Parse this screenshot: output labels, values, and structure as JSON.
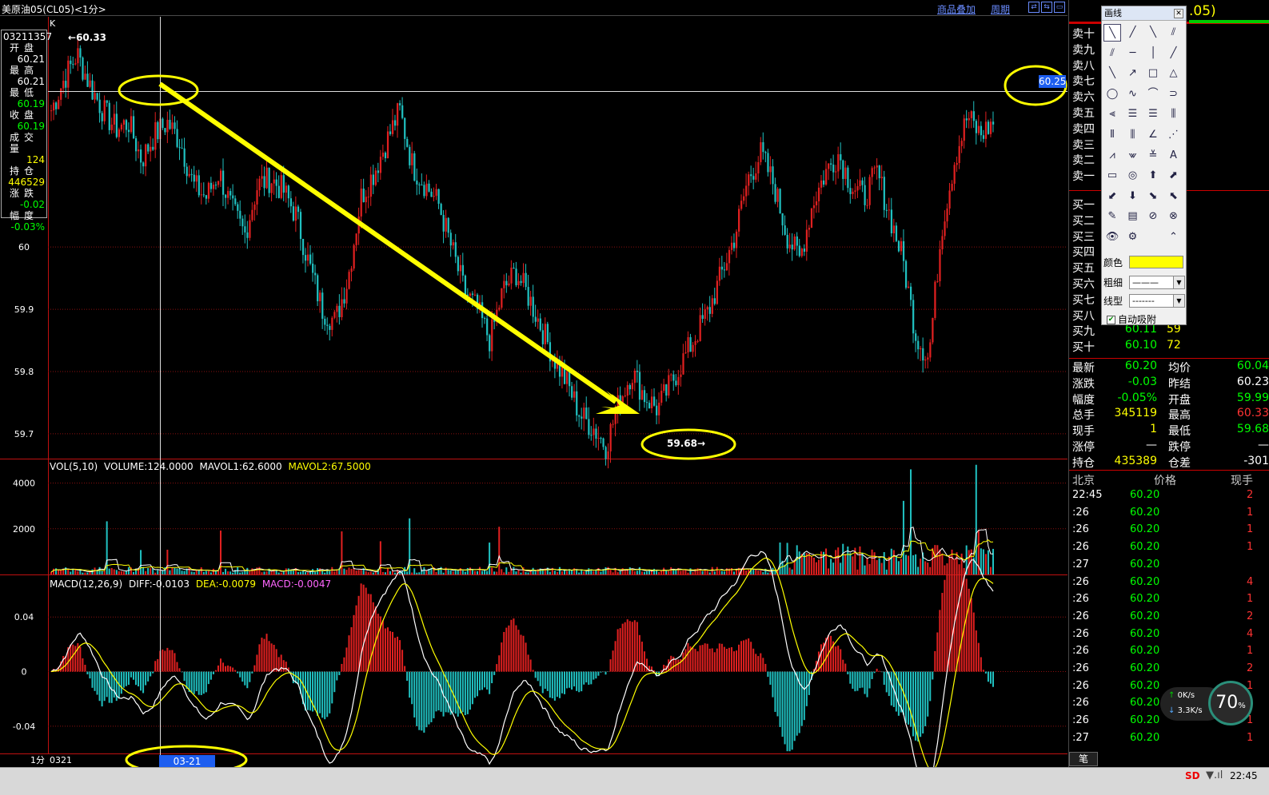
{
  "topbar": {
    "title": "美原油05(CL05)<1分>",
    "overlay_link": "商品叠加",
    "period_link": "周期",
    "nav_buttons": [
      "⇄",
      "⇆",
      "▭"
    ]
  },
  "chart_data": [
    {
      "type": "candlestick",
      "name": "",
      "indicator_label": "K",
      "ylim": [
        59.66,
        60.37
      ],
      "y_ticks": [
        60.0,
        59.9,
        59.8,
        59.7
      ],
      "high_marker": "60.33",
      "low_marker": "59.68",
      "crosshair_price": "60.25",
      "crosshair_date": "03-21 13:57",
      "price_path": [
        60.22,
        60.27,
        60.31,
        60.26,
        60.22,
        60.19,
        60.2,
        60.14,
        60.18,
        60.2,
        60.17,
        60.1,
        60.08,
        60.12,
        60.06,
        60.02,
        60.1,
        60.11,
        60.09,
        60.05,
        59.97,
        59.9,
        59.88,
        59.95,
        60.08,
        60.12,
        60.17,
        60.22,
        60.13,
        60.1,
        60.07,
        60.0,
        59.93,
        59.9,
        59.85,
        59.93,
        59.96,
        59.92,
        59.87,
        59.82,
        59.78,
        59.73,
        59.71,
        59.68,
        59.75,
        59.8,
        59.76,
        59.74,
        59.78,
        59.82,
        59.86,
        59.9,
        59.96,
        60.02,
        60.11,
        60.15,
        60.1,
        60.02,
        59.98,
        60.07,
        60.12,
        60.15,
        60.1,
        60.08,
        60.12,
        60.05,
        59.98,
        59.86,
        59.82,
        60.03,
        60.14,
        60.21,
        60.18,
        60.2
      ]
    },
    {
      "type": "bar",
      "name": "",
      "indicator_label": "VOL(5,10)",
      "volume_label": "VOLUME:124.0000",
      "mavol1_label": "MAVOL1:62.6000",
      "mavol2_label": "MAVOL2:67.5000",
      "ylim": [
        0,
        5000
      ],
      "y_ticks": [
        4000,
        2000
      ]
    },
    {
      "type": "bar",
      "name": "",
      "indicator_label": "MACD(12,26,9)",
      "diff_label": "DIFF:-0.0103",
      "dea_label": "DEA:-0.0079",
      "macd_label": "MACD:-0.0047",
      "ylim": [
        -0.06,
        0.07
      ],
      "y_ticks": [
        0.04,
        0,
        -0.04
      ],
      "y_tick_labels": [
        "0.04",
        "0",
        "-0.04"
      ]
    }
  ],
  "bottom": {
    "period": "1分",
    "date": "0321"
  },
  "info_box": {
    "code": "03211357",
    "rows": [
      {
        "label": "开盘",
        "value": "60.21",
        "color": "#ffffff"
      },
      {
        "label": "最高",
        "value": "60.21",
        "color": "#ffffff"
      },
      {
        "label": "最低",
        "value": "60.19",
        "color": "#00ff00"
      },
      {
        "label": "收盘",
        "value": "60.19",
        "color": "#00ff00"
      },
      {
        "label": "成交量",
        "value": "124",
        "color": "#ffff00"
      },
      {
        "label": "持仓",
        "value": "446529",
        "color": "#ffff00"
      },
      {
        "label": "涨跌",
        "value": "-0.02",
        "color": "#00ff00"
      },
      {
        "label": "幅度",
        "value": "-0.03%",
        "color": "#00ff00"
      }
    ]
  },
  "right_panel": {
    "header_code": ".05)",
    "sell_labels": [
      "卖十",
      "卖九",
      "卖八",
      "卖七",
      "卖六",
      "卖五",
      "卖四",
      "卖三",
      "卖二",
      "卖一"
    ],
    "buy_labels": [
      "买一",
      "买二",
      "买三",
      "买四",
      "买五",
      "买六",
      "买七",
      "买八"
    ],
    "buy_with_values": [
      {
        "label": "买九",
        "price": "60.11",
        "vol": "59"
      },
      {
        "label": "买十",
        "price": "60.10",
        "vol": "72"
      }
    ],
    "quote": [
      {
        "l1": "最新",
        "v1": "60.20",
        "c1": "#00ff00",
        "l2": "均价",
        "v2": "60.04",
        "c2": "#00ff00"
      },
      {
        "l1": "涨跌",
        "v1": "-0.03",
        "c1": "#00ff00",
        "l2": "昨结",
        "v2": "60.23",
        "c2": "#ffffff"
      },
      {
        "l1": "幅度",
        "v1": "-0.05%",
        "c1": "#00ff00",
        "l2": "开盘",
        "v2": "59.99",
        "c2": "#00ff00"
      },
      {
        "l1": "总手",
        "v1": "345119",
        "c1": "#ffff00",
        "l2": "最高",
        "v2": "60.33",
        "c2": "#ff3333"
      },
      {
        "l1": "现手",
        "v1": "1",
        "c1": "#ffff00",
        "l2": "最低",
        "v2": "59.68",
        "c2": "#00ff00"
      },
      {
        "l1": "涨停",
        "v1": "—",
        "c1": "#ffffff",
        "l2": "跌停",
        "v2": "—",
        "c2": "#ffffff"
      },
      {
        "l1": "持仓",
        "v1": "435389",
        "c1": "#ffff00",
        "l2": "仓差",
        "v2": "-301",
        "c2": "#ffffff"
      }
    ],
    "ticks_header": {
      "time": "北京",
      "price": "价格",
      "vol": "现手"
    },
    "ticks": [
      {
        "time": "22:45",
        "price": "60.20",
        "vol": "2"
      },
      {
        "time": ":26",
        "price": "60.20",
        "vol": "1"
      },
      {
        "time": ":26",
        "price": "60.20",
        "vol": "1"
      },
      {
        "time": ":26",
        "price": "60.20",
        "vol": "1"
      },
      {
        "time": ":27",
        "price": "60.20",
        "vol": ""
      },
      {
        "time": ":26",
        "price": "60.20",
        "vol": "4"
      },
      {
        "time": ":26",
        "price": "60.20",
        "vol": "1"
      },
      {
        "time": ":26",
        "price": "60.20",
        "vol": "2"
      },
      {
        "time": ":26",
        "price": "60.20",
        "vol": "4"
      },
      {
        "time": ":26",
        "price": "60.20",
        "vol": "1"
      },
      {
        "time": ":26",
        "price": "60.20",
        "vol": "2"
      },
      {
        "time": ":26",
        "price": "60.20",
        "vol": "1"
      },
      {
        "time": ":26",
        "price": "60.20",
        "vol": "1"
      },
      {
        "time": ":26",
        "price": "60.20",
        "vol": "1"
      },
      {
        "time": ":27",
        "price": "60.20",
        "vol": "1"
      }
    ],
    "tab": "笔"
  },
  "draw_tool": {
    "title": "画线",
    "color_label": "颜色",
    "color_value": "#ffff00",
    "width_label": "粗细",
    "width_value": "———",
    "style_label": "线型",
    "style_value": "-------",
    "auto_attach_label": "自动吸附",
    "tools": [
      "line-segment-icon",
      "ray-icon",
      "line-icon",
      "parallel-icon",
      "parallel-channel-icon",
      "horizontal-line-icon",
      "vertical-line-icon",
      "trend-line-icon",
      "down-line-icon",
      "up-arrow-line-icon",
      "rectangle-icon",
      "triangle-icon",
      "ellipse-icon",
      "wave-icon",
      "arc-icon",
      "half-circle-icon",
      "fib-fan-icon",
      "fib-retracement-icon",
      "fib-extension-icon",
      "fib-timezone-icon",
      "cycle-line-icon",
      "fib-cycle-icon",
      "angle-icon",
      "gann-fan-icon",
      "speed-line-icon",
      "pitchfork-icon",
      "price-channel-icon",
      "text-icon",
      "ruler-icon",
      "target-icon",
      "up-arrow-icon",
      "up-right-arrow-icon",
      "down-left-arrow-icon",
      "down-arrow-icon",
      "down-right-arrow-icon",
      "up-left-arrow-icon",
      "eraser-icon",
      "color-layers-icon",
      "hide-icon",
      "lock-icon",
      "eye-icon",
      "settings-icon",
      "",
      "collapse-icon"
    ],
    "tool_glyphs": [
      "╲",
      "╱",
      "╲",
      "⫽",
      "⫽",
      "─",
      "│",
      "╱",
      "╲",
      "↗",
      "□",
      "△",
      "◯",
      "∿",
      "⌒",
      "⊃",
      "⫷",
      "☰",
      "☰",
      "⫼",
      "⦀",
      "⫼",
      "∠",
      "⋰",
      "⩘",
      "⩖",
      "≚",
      "A",
      "▭",
      "◎",
      "⬆",
      "⬈",
      "⬋",
      "⬇",
      "⬊",
      "⬉",
      "✎",
      "▤",
      "⊘",
      "⊗",
      "👁",
      "⚙",
      "",
      "⌃"
    ]
  },
  "speed_widget": {
    "up": "0K/s",
    "down": "3.3K/s",
    "percent": "70",
    "unit": "%"
  },
  "statusbar": {
    "brand": "SD",
    "signal": "▼.ıl",
    "clock": "22:45"
  },
  "colors": {
    "up": "#e02020",
    "down": "#20c0c0",
    "grid": "#8a1010",
    "arrow": "#ffff00",
    "text_green": "#00ff00",
    "text_yellow": "#ffff00",
    "text_red": "#ff3333"
  }
}
